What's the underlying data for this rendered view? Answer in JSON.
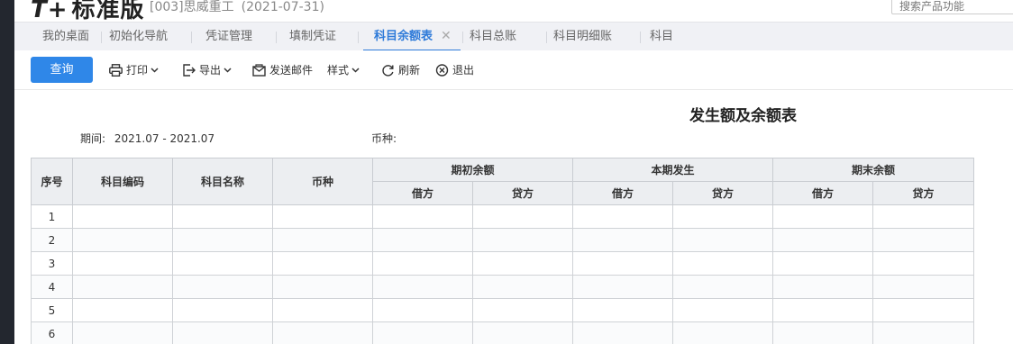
{
  "app": {
    "logo_mark": "T+",
    "logo_text": "标准版",
    "company": "[003]思威重工",
    "period_date": "(2021-07-31)",
    "search_placeholder": "搜索产品功能"
  },
  "tabs": [
    {
      "label": "我的桌面"
    },
    {
      "label": "初始化导航"
    },
    {
      "label": "凭证管理"
    },
    {
      "label": "填制凭证"
    },
    {
      "label": "科目余额表",
      "active": true
    },
    {
      "label": "科目总账"
    },
    {
      "label": "科目明细账"
    },
    {
      "label": "科目"
    }
  ],
  "tab_close_glyph": "✕",
  "toolbar": {
    "query": "查询",
    "print": "打印",
    "export": "导出",
    "send_mail": "发送邮件",
    "style": "样式",
    "refresh": "刷新",
    "exit": "退出"
  },
  "report": {
    "title": "发生额及余额表",
    "period_label": "期间:",
    "period_value": "2021.07 - 2021.07",
    "currency_label": "币种:",
    "currency_value": ""
  },
  "table": {
    "headers": {
      "seq": "序号",
      "code": "科目编码",
      "name": "科目名称",
      "currency": "币种",
      "opening": "期初余额",
      "current": "本期发生",
      "closing": "期末余额",
      "debit": "借方",
      "credit": "贷方"
    },
    "rows": [
      {
        "seq": "1"
      },
      {
        "seq": "2"
      },
      {
        "seq": "3"
      },
      {
        "seq": "4"
      },
      {
        "seq": "5"
      },
      {
        "seq": "6"
      }
    ]
  },
  "icons": {
    "print": "printer-icon",
    "export": "export-icon",
    "send_mail": "mail-icon",
    "refresh": "refresh-icon",
    "exit": "close-circle-icon"
  },
  "colors": {
    "accent": "#2f7bd9",
    "primary_button": "#2f87e8",
    "header_bg": "#eceef1",
    "sidebar": "#23272f"
  }
}
